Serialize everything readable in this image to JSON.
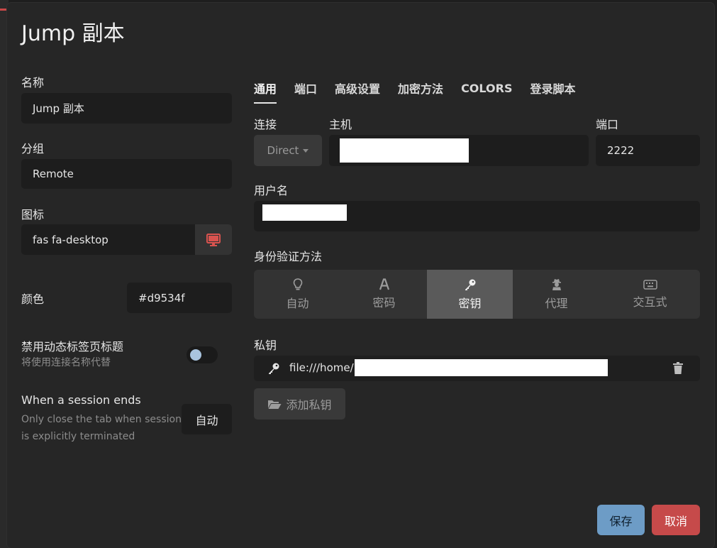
{
  "dialog": {
    "title": "Jump 副本"
  },
  "left": {
    "name_label": "名称",
    "name_value": "Jump 副本",
    "group_label": "分组",
    "group_value": "Remote",
    "icon_label": "图标",
    "icon_value": "fas fa-desktop",
    "color_label": "颜色",
    "color_value": "#d9534f",
    "disable_dynamic_title_label": "禁用动态标签页标题",
    "disable_dynamic_title_hint": "将使用连接名称代替",
    "session_end_label": "When a session ends",
    "session_end_hint_line1": "Only close the tab when session",
    "session_end_hint_line2": "is explicitly terminated",
    "session_end_value": "自动"
  },
  "tabs": [
    {
      "label": "通用"
    },
    {
      "label": "端口"
    },
    {
      "label": "高级设置"
    },
    {
      "label": "加密方法"
    },
    {
      "label": "COLORS"
    },
    {
      "label": "登录脚本"
    }
  ],
  "general": {
    "connection_label": "连接",
    "connection_value": "Direct",
    "host_label": "主机",
    "port_label": "端口",
    "port_value": "2222",
    "username_label": "用户名",
    "auth_label": "身份验证方法",
    "auth_options": [
      {
        "label": "自动",
        "icon": "lightbulb-icon"
      },
      {
        "label": "密码",
        "icon": "font-icon"
      },
      {
        "label": "密钥",
        "icon": "key-icon"
      },
      {
        "label": "代理",
        "icon": "user-secret-icon"
      },
      {
        "label": "交互式",
        "icon": "keyboard-icon"
      }
    ],
    "auth_selected": "密钥",
    "private_key_label": "私钥",
    "private_key_path": "file:///home/",
    "add_key_label": "添加私钥"
  },
  "footer": {
    "save_label": "保存",
    "cancel_label": "取消"
  },
  "colors": {
    "accent_icon": "#d9534f",
    "save": "#6d9cc6",
    "cancel": "#c64a4a"
  }
}
